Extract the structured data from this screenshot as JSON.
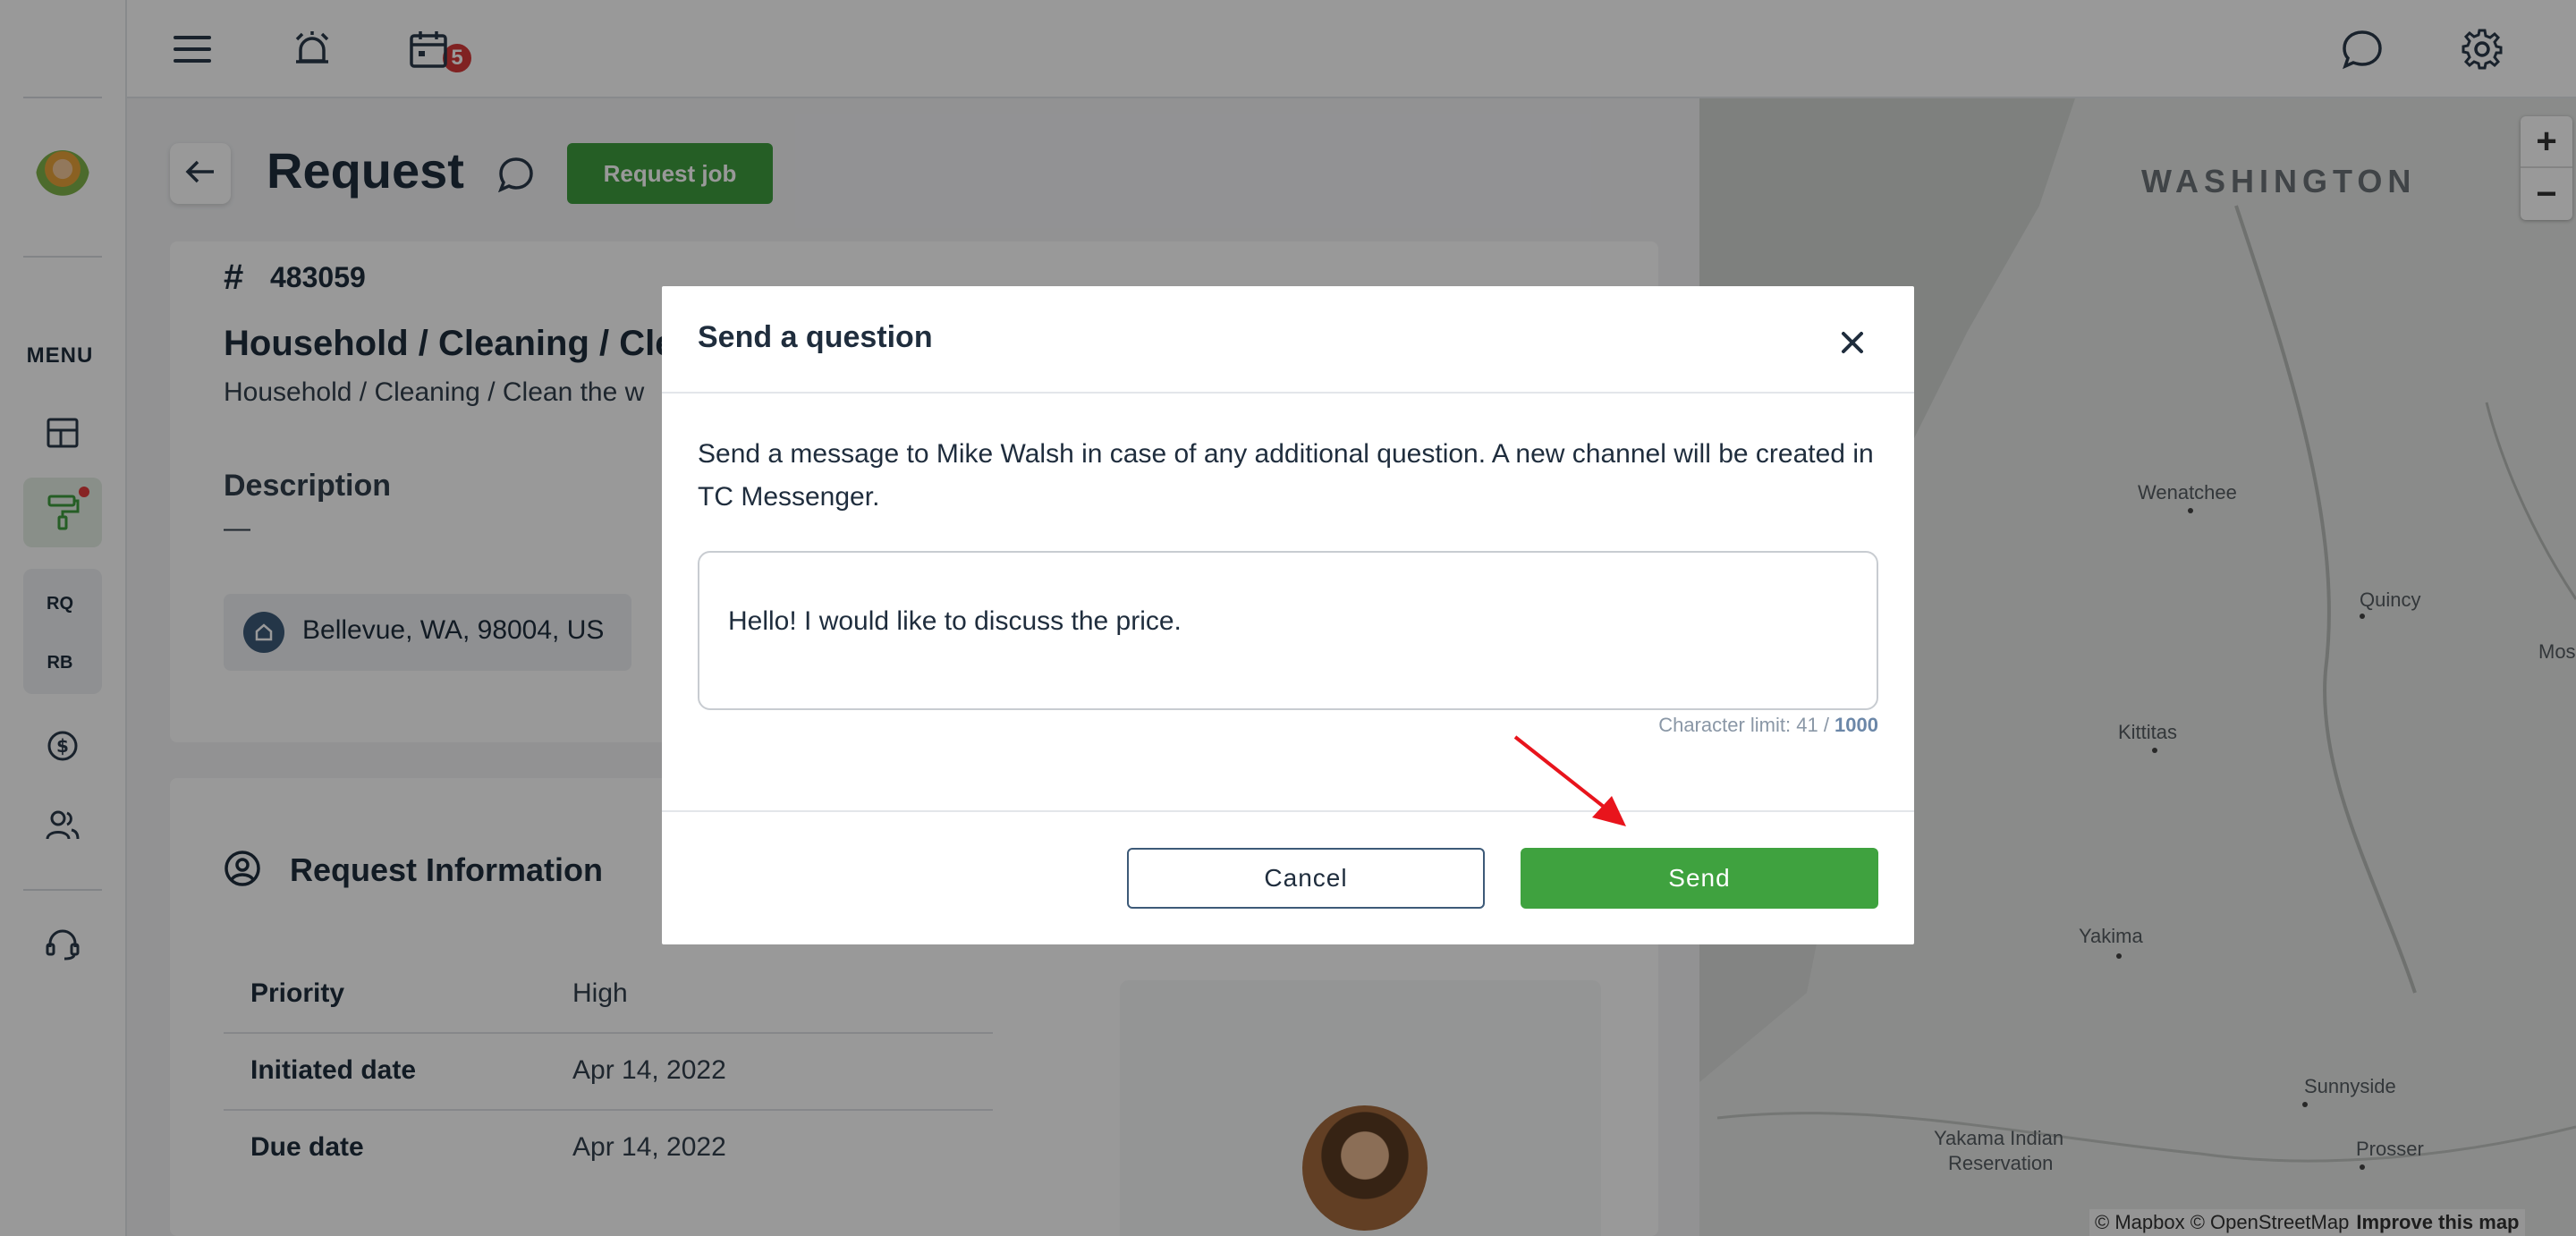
{
  "sidebar": {
    "menu_label": "MENU",
    "short_items": [
      "RQ",
      "RB"
    ]
  },
  "topbar": {
    "notification_count": "5"
  },
  "page": {
    "title": "Request",
    "request_job_label": "Request job",
    "hash_symbol": "#",
    "request_id": "483059",
    "category_title": "Household / Cleaning / Clea",
    "category_subtitle": "Household / Cleaning / Clean the w",
    "description_label": "Description",
    "description_value": "—",
    "address": "Bellevue, WA, 98004, US",
    "request_info_title": "Request Information",
    "info_rows": [
      {
        "label": "Priority",
        "value": "High"
      },
      {
        "label": "Initiated date",
        "value": "Apr 14, 2022"
      },
      {
        "label": "Due date",
        "value": "Apr 14, 2022"
      }
    ]
  },
  "map": {
    "state_label": "WASHINGTON",
    "places": [
      "Wenatchee",
      "Quincy",
      "Moses",
      "Kittitas",
      "Yakima",
      "Sunnyside",
      "Yakama Indian",
      "Reservation",
      "Prosser"
    ],
    "zoom_in": "+",
    "zoom_out": "−",
    "attribution": "© Mapbox © OpenStreetMap",
    "improve_link": "Improve this map"
  },
  "modal": {
    "title": "Send a question",
    "message": "Send a message to Mike Walsh in case of any additional question. A new channel will be created in TC Messenger.",
    "textarea_value": "Hello! I would like to discuss the price.",
    "char_limit_prefix": "Character limit: 41 / ",
    "char_limit_max": "1000",
    "cancel_label": "Cancel",
    "send_label": "Send"
  },
  "colors": {
    "primary_green": "#3fa23f",
    "navy": "#1f2d3d",
    "badge_red": "#d63a3a",
    "annotation_arrow": "#e8141c"
  }
}
